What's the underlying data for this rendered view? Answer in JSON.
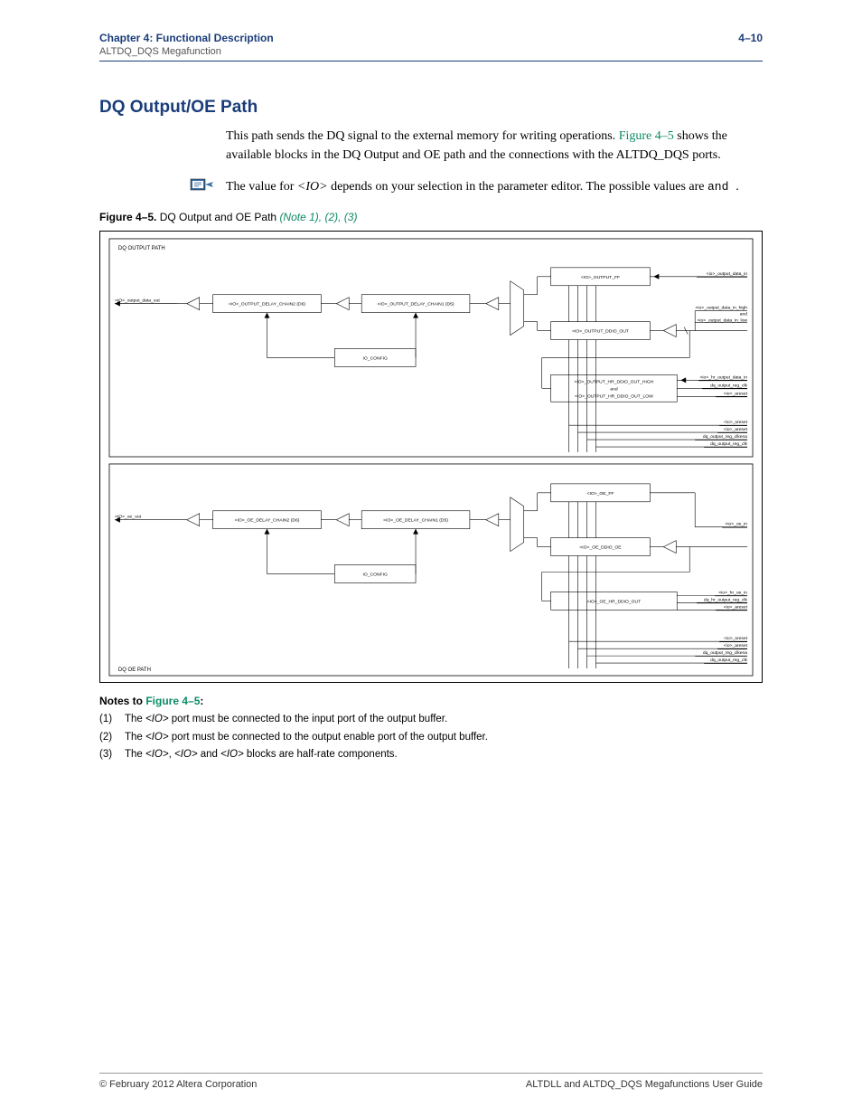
{
  "header": {
    "chapter_bold": "Chapter 4:  Functional Description",
    "page_num": "4–10",
    "subtitle": "ALTDQ_DQS Megafunction"
  },
  "section_title": "DQ Output/OE Path",
  "paragraph1_a": "This path sends the DQ signal to the external memory for writing operations.",
  "paragraph1_link": "Figure 4–5",
  "paragraph1_b": " shows the available blocks in the DQ Output and OE path and the connections with the ALTDQ_DQS ports.",
  "note_a": "The value for ",
  "note_io": "<IO>",
  "note_b": " depends on your selection in the parameter editor. The possible values are ",
  "note_c": " and ",
  "note_d": ".",
  "figcap_a": "Figure 4–5.",
  "figcap_b": " DQ Output and OE Path  ",
  "figcap_c": "(Note 1)",
  "figcap_d": ", ",
  "figcap_e": "(2)",
  "figcap_f": ", ",
  "figcap_g": "(3)",
  "diagram": {
    "top_title": "DQ OUTPUT PATH",
    "top_left_sig": "<IO>_output_data_out",
    "top_d6": "<IO>_OUTPUT_DELAY_CHAIN2 (D6)",
    "top_d5": "<IO>_OUTPUT_DELAY_CHAIN1 (D5)",
    "io_config": "IO_CONFIG",
    "output_ff": "<IO>_OUTPUT_FF",
    "output_ddio": "<IO>_OUTPUT_DDIO_OUT",
    "output_hr_high": "<IO>_OUTPUT_HR_DDIO_OUT_HIGH",
    "output_hr_and": "and",
    "output_hr_low": "<IO>_OUTPUT_HR_DDIO_OUT_LOW",
    "sig_data_in": "<io>_output_data_in",
    "sig_data_high": "<io>_output_data_in_high",
    "sig_data_and": "and",
    "sig_data_low": "<io>_output_data_in_low",
    "sig_hr_data": "<io>_hr_output_data_in",
    "sig_hr_clk": "dq_output_reg_clk",
    "sig_hr_areset": "<io>_areset",
    "mid_sreset": "<io>_sreset",
    "mid_areset": "<io>_areset",
    "mid_clkena": "dq_output_reg_clkena",
    "mid_clk": "dq_output_reg_clk",
    "bot_title": "DQ OE PATH",
    "bot_left_sig": "<IO>_oe_out",
    "bot_d6": "<IO>_OE_DELAY_CHAIN2 (D6)",
    "bot_d5": "<IO>_OE_DELAY_CHAIN1 (D5)",
    "oe_ff": "<IO>_OE_FF",
    "oe_ddio": "<IO>_OE_DDIO_OE",
    "oe_hr": "<IO>_OE_HR_DDIO_OUT",
    "sig_oe_in": "<io>_oe_in",
    "sig_hr_oe_in": "<io>_hr_oe_in",
    "sig_hr_oe_clk": "dq_hr_output_reg_clk",
    "sig_hr_oe_areset": "<io>_areset",
    "bot_sreset": "<io>_sreset",
    "bot_areset": "<io>_areset",
    "bot_clkena": "dq_output_reg_clkena",
    "bot_clk": "dq_output_reg_clk"
  },
  "notes_heading_a": "Notes to ",
  "notes_heading_b": "Figure 4–5",
  "notes_heading_c": ":",
  "notes": {
    "n1_num": "(1)",
    "n1_a": "The  ",
    "n1_io": "<IO>",
    "n1_b": " port must be connected to the input port of the output buffer.",
    "n2_num": "(2)",
    "n2_a": "The ",
    "n2_io": "<IO>",
    "n2_b": " port must be connected to the output enable port of the output buffer.",
    "n3_num": "(3)",
    "n3_a": "The ",
    "n3_io1": "<IO>",
    "n3_b": ", ",
    "n3_io2": "<IO>",
    "n3_c": " and ",
    "n3_io3": "<IO>",
    "n3_d": " blocks are half-rate components."
  },
  "footer": {
    "left": "© February 2012   Altera Corporation",
    "right": "ALTDLL and ALTDQ_DQS Megafunctions User Guide"
  }
}
